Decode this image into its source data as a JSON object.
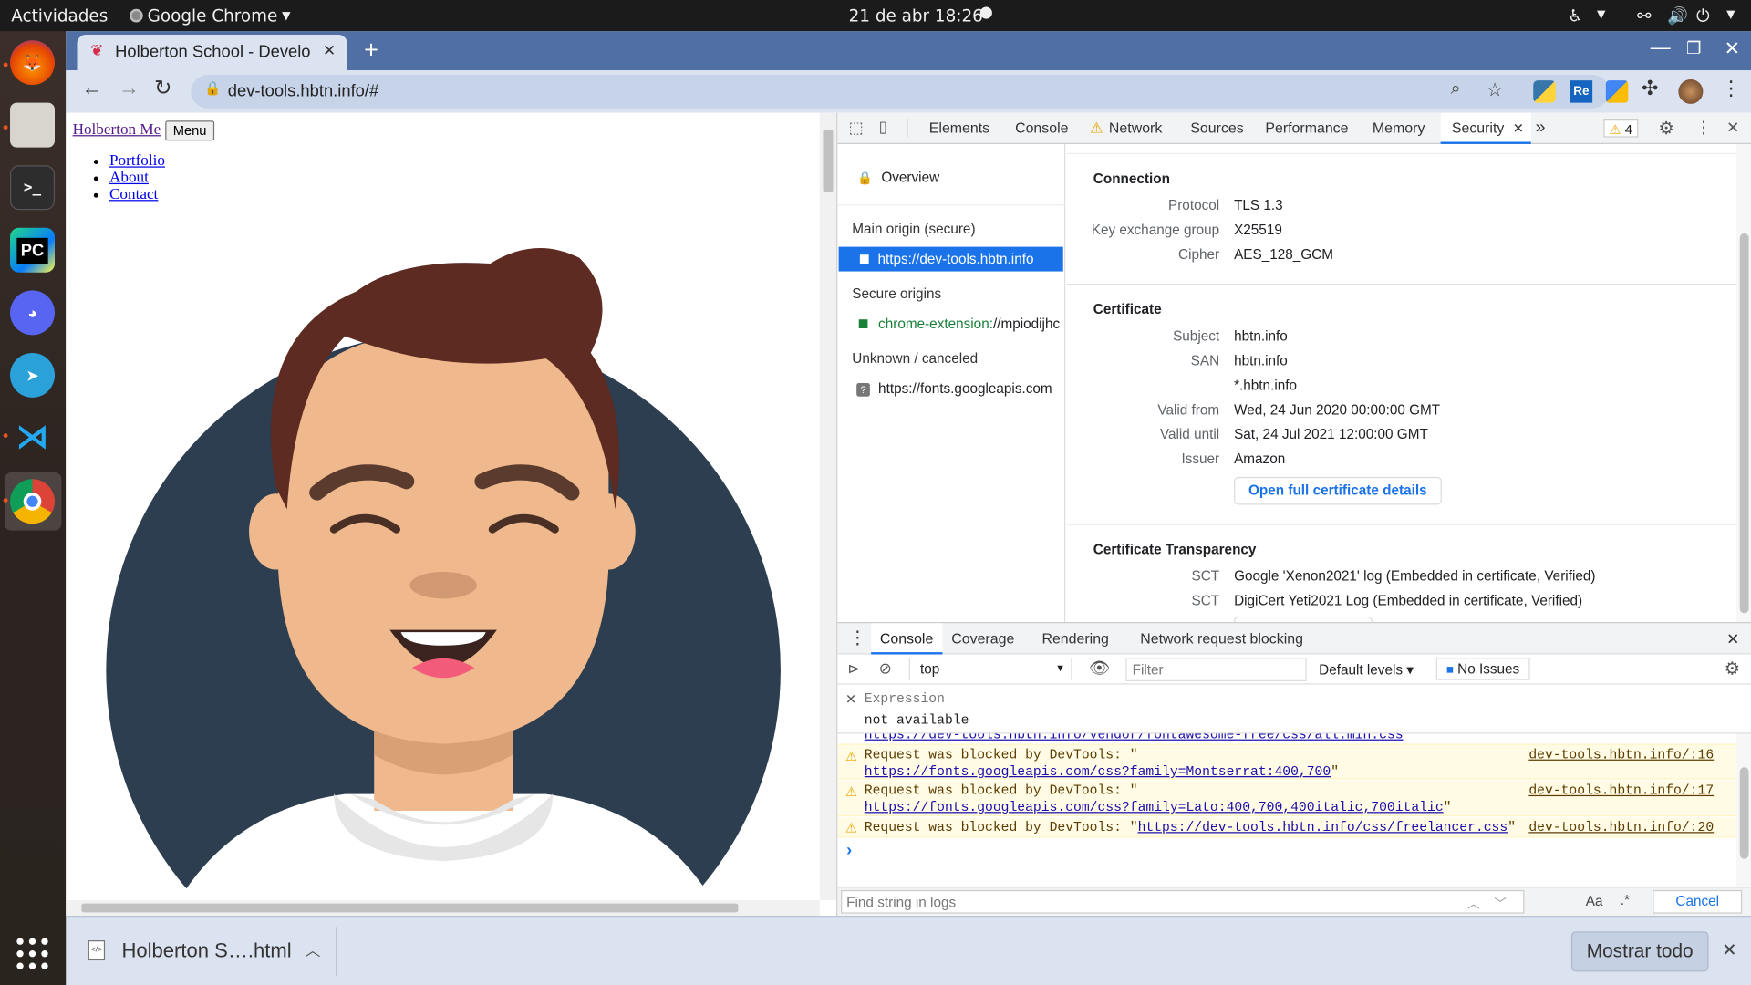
{
  "topbar": {
    "activities": "Actividades",
    "app_name": "Google Chrome",
    "datetime": "21 de abr  18:26"
  },
  "dock": {
    "items": [
      "firefox-icon",
      "files-icon",
      "terminal-icon",
      "pycharm-icon",
      "discord-icon",
      "telegram-icon",
      "vscode-icon",
      "chrome-icon"
    ],
    "show_apps": "show-apps-icon"
  },
  "browser": {
    "tab_title": "Holberton School - Develo",
    "url": "dev-tools.hbtn.info/#"
  },
  "page": {
    "brand": "Holberton Me",
    "menu_button": "Menu",
    "nav": [
      "Portfolio",
      "About",
      "Contact"
    ]
  },
  "devtools": {
    "tabs": [
      "Elements",
      "Console",
      "Network",
      "Sources",
      "Performance",
      "Memory",
      "Security"
    ],
    "active_tab": "Security",
    "more_tabs": "»",
    "warnings_count": "4",
    "security_sidebar": {
      "overview": "Overview",
      "main_origin_heading": "Main origin (secure)",
      "main_origin": "https://dev-tools.hbtn.info",
      "secure_origins_heading": "Secure origins",
      "secure_origin_scheme": "chrome-extension:",
      "secure_origin_rest": "//mpiodijhc",
      "unknown_heading": "Unknown / canceled",
      "unknown_origin": "https://fonts.googleapis.com"
    },
    "connection": {
      "heading": "Connection",
      "rows": [
        {
          "label": "Protocol",
          "value": "TLS 1.3"
        },
        {
          "label": "Key exchange group",
          "value": "X25519"
        },
        {
          "label": "Cipher",
          "value": "AES_128_GCM"
        }
      ]
    },
    "certificate": {
      "heading": "Certificate",
      "rows": [
        {
          "label": "Subject",
          "value": "hbtn.info"
        },
        {
          "label": "SAN",
          "value": "hbtn.info"
        },
        {
          "label": "",
          "value": "*.hbtn.info"
        },
        {
          "label": "Valid from",
          "value": "Wed, 24 Jun 2020 00:00:00 GMT"
        },
        {
          "label": "Valid until",
          "value": "Sat, 24 Jul 2021 12:00:00 GMT"
        },
        {
          "label": "Issuer",
          "value": "Amazon"
        }
      ],
      "details_button": "Open full certificate details"
    },
    "transparency": {
      "heading": "Certificate Transparency",
      "rows": [
        {
          "label": "SCT",
          "value": "Google 'Xenon2021' log (Embedded in certificate, Verified)"
        },
        {
          "label": "SCT",
          "value": "DigiCert Yeti2021 Log (Embedded in certificate, Verified)"
        }
      ]
    },
    "drawer": {
      "tabs": [
        "Console",
        "Coverage",
        "Rendering",
        "Network request blocking"
      ],
      "context": "top",
      "filter_placeholder": "Filter",
      "levels": "Default levels ▾",
      "issues": "No Issues",
      "expression_label": "Expression",
      "expression_value": "not available",
      "clipped_line": "https://dev-tools.hbtn.info/vendor/fontawesome-free/css/all.min.css",
      "messages": [
        {
          "prefix": "Request was blocked by DevTools: \"",
          "link": "https://fonts.googleapis.com/css?family=Montserrat:400,700",
          "suffix": "\"",
          "source": "dev-tools.hbtn.info/:16"
        },
        {
          "prefix": "Request was blocked by DevTools: \"",
          "link": "https://fonts.googleapis.com/css?family=Lato:400,700,400italic,700italic",
          "suffix": "\"",
          "source": "dev-tools.hbtn.info/:17"
        },
        {
          "prefix": "Request was blocked by DevTools: \"",
          "link": "https://dev-tools.hbtn.info/css/freelancer.css",
          "suffix": "\"",
          "source": "dev-tools.hbtn.info/:20"
        }
      ],
      "prompt": "›",
      "find_placeholder": "Find string in logs",
      "match_case": "Aa",
      "regex": ".*",
      "cancel": "Cancel"
    }
  },
  "downloads": {
    "file": "Holberton S….html",
    "show_all": "Mostrar todo"
  },
  "colors": {
    "tab_strip": "#4f6fa5",
    "toolbar": "#dbe3f1",
    "accent": "#1a73e8",
    "warning_bg": "#fffbe5",
    "avatar_bg": "#2c3e50"
  }
}
